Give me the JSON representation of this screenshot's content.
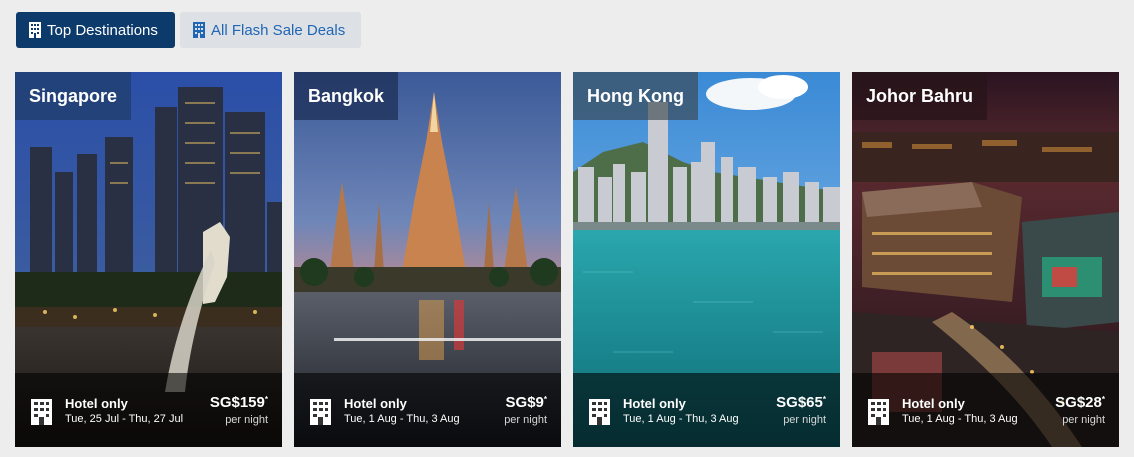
{
  "tabs": [
    {
      "label": "Top Destinations",
      "active": true,
      "icon": "building-icon"
    },
    {
      "label": "All Flash Sale Deals",
      "active": false,
      "icon": "building-icon"
    }
  ],
  "cards": [
    {
      "city": "Singapore",
      "type": "Hotel only",
      "dates": "Tue, 25 Jul - Thu, 27 Jul",
      "price": "SG$159",
      "asterisk": "*",
      "per": "per night",
      "icon": "building-icon"
    },
    {
      "city": "Bangkok",
      "type": "Hotel only",
      "dates": "Tue, 1 Aug - Thu, 3 Aug",
      "price": "SG$9",
      "asterisk": "*",
      "per": "per night",
      "icon": "building-icon"
    },
    {
      "city": "Hong Kong",
      "type": "Hotel only",
      "dates": "Tue, 1 Aug - Thu, 3 Aug",
      "price": "SG$65",
      "asterisk": "*",
      "per": "per night",
      "icon": "building-icon"
    },
    {
      "city": "Johor Bahru",
      "type": "Hotel only",
      "dates": "Tue, 1 Aug - Thu, 3 Aug",
      "price": "SG$28",
      "asterisk": "*",
      "per": "per night",
      "icon": "building-icon"
    }
  ],
  "colors": {
    "active_tab": "#0b3a6b",
    "inactive_tab": "#dde1e5",
    "inactive_text": "#1f66b5",
    "city_label_bg": "#1f3f6e"
  }
}
